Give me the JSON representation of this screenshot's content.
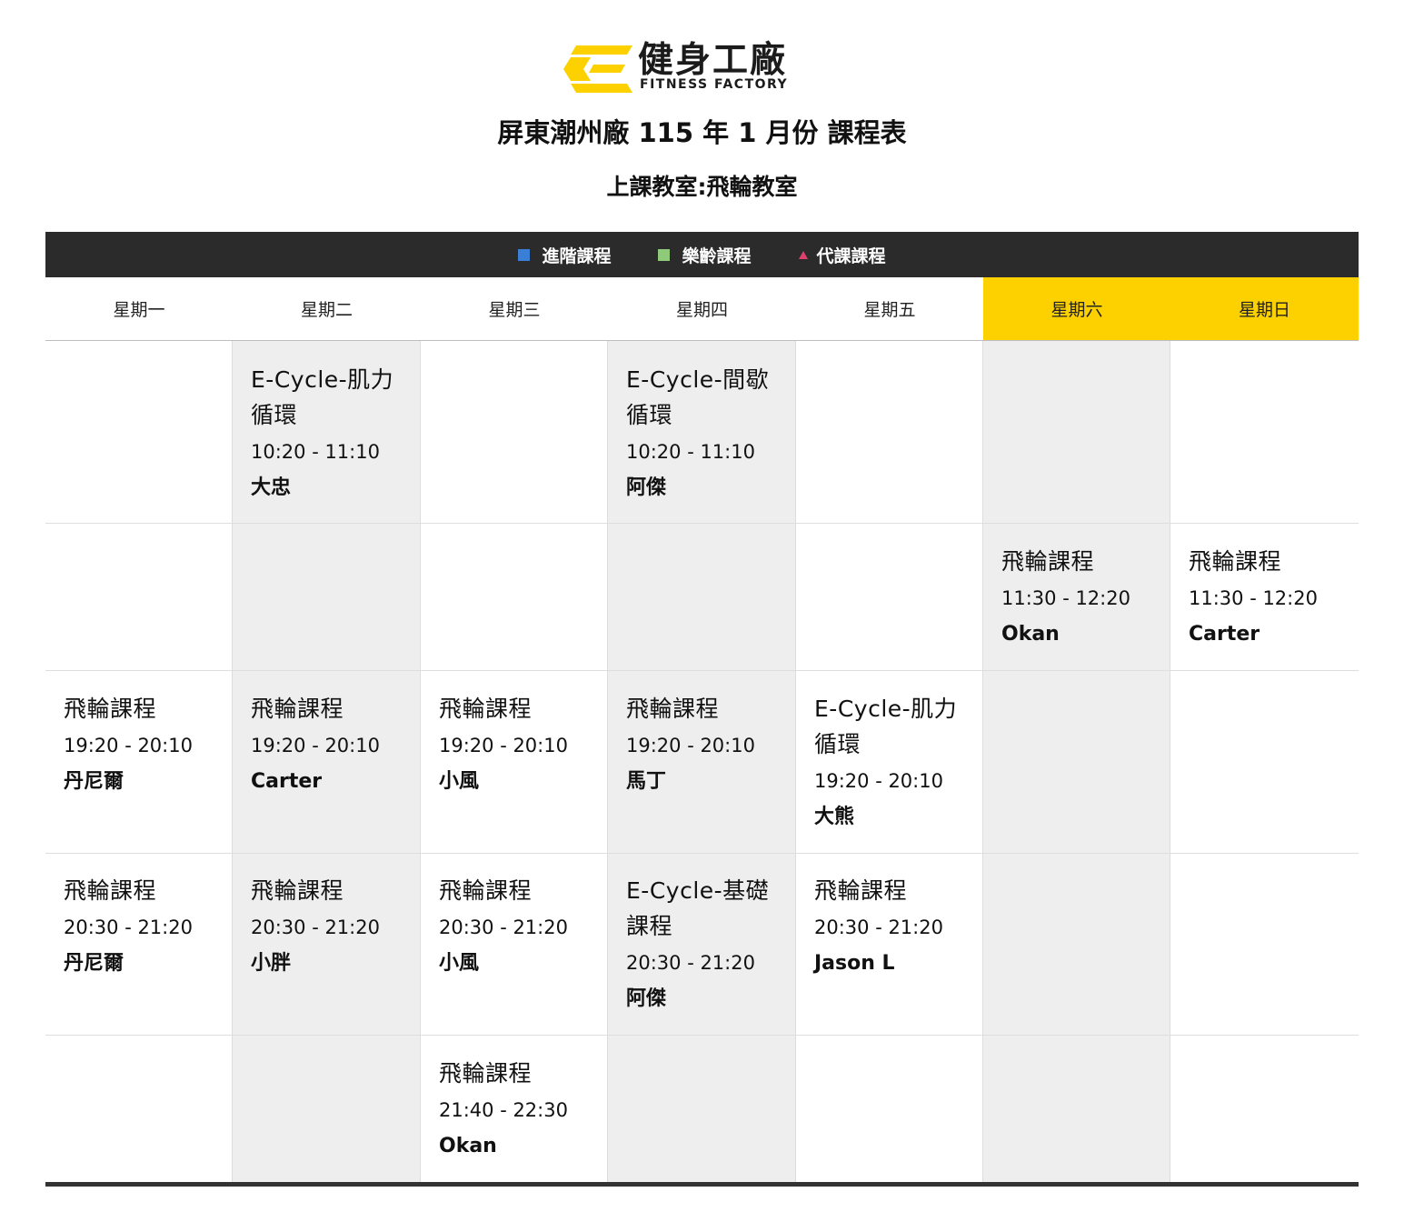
{
  "logo": {
    "cn": "健身工廠",
    "en": "FITNESS FACTORY",
    "brand_color": "#FDD000",
    "icon": "fitness-factory-logo-icon"
  },
  "title": "屏東潮州廠 115 年 1 月份 課程表",
  "subtitle": "上課教室:飛輪教室",
  "legend": [
    {
      "label": "進階課程",
      "color": "#3a7fd5",
      "icon": "blue-square-icon"
    },
    {
      "label": "樂齡課程",
      "color": "#8fc97a",
      "icon": "green-square-icon"
    },
    {
      "label": "代課課程",
      "color": "#e0406e",
      "icon": "pink-triangle-icon"
    }
  ],
  "days": [
    "星期一",
    "星期二",
    "星期三",
    "星期四",
    "星期五",
    "星期六",
    "星期日"
  ],
  "colors": {
    "header_bar": "#2B2B2B",
    "weekend": "#FDD000",
    "shaded_column": "#EEEEEE"
  },
  "rows": [
    [
      null,
      {
        "name": "E-Cycle-肌力循環",
        "time": "10:20 - 11:10",
        "teacher": "大忠"
      },
      null,
      {
        "name": "E-Cycle-間歇循環",
        "time": "10:20 - 11:10",
        "teacher": "阿傑"
      },
      null,
      null,
      null
    ],
    [
      null,
      null,
      null,
      null,
      null,
      {
        "name": "飛輪課程",
        "time": "11:30 - 12:20",
        "teacher": "Okan"
      },
      {
        "name": "飛輪課程",
        "time": "11:30 - 12:20",
        "teacher": "Carter"
      }
    ],
    [
      {
        "name": "飛輪課程",
        "time": "19:20 - 20:10",
        "teacher": "丹尼爾"
      },
      {
        "name": "飛輪課程",
        "time": "19:20 - 20:10",
        "teacher": "Carter"
      },
      {
        "name": "飛輪課程",
        "time": "19:20 - 20:10",
        "teacher": "小風"
      },
      {
        "name": "飛輪課程",
        "time": "19:20 - 20:10",
        "teacher": "馬丁"
      },
      {
        "name": "E-Cycle-肌力循環",
        "time": "19:20 - 20:10",
        "teacher": "大熊"
      },
      null,
      null
    ],
    [
      {
        "name": "飛輪課程",
        "time": "20:30 - 21:20",
        "teacher": "丹尼爾"
      },
      {
        "name": "飛輪課程",
        "time": "20:30 - 21:20",
        "teacher": "小胖"
      },
      {
        "name": "飛輪課程",
        "time": "20:30 - 21:20",
        "teacher": "小風"
      },
      {
        "name": "E-Cycle-基礎課程",
        "time": "20:30 - 21:20",
        "teacher": "阿傑"
      },
      {
        "name": "飛輪課程",
        "time": "20:30 - 21:20",
        "teacher": "Jason L"
      },
      null,
      null
    ],
    [
      null,
      null,
      {
        "name": "飛輪課程",
        "time": "21:40 - 22:30",
        "teacher": "Okan"
      },
      null,
      null,
      null,
      null
    ]
  ]
}
